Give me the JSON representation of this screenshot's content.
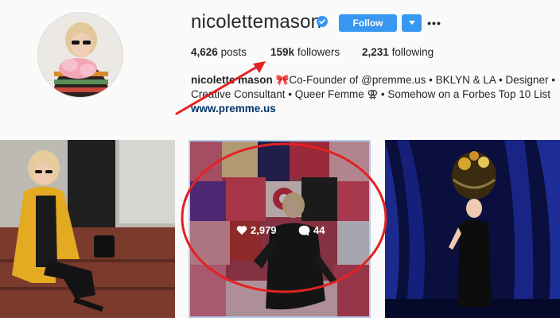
{
  "profile": {
    "username": "nicolettemason",
    "follow_label": "Follow",
    "stats": {
      "posts_count": "4,626",
      "posts_label": "posts",
      "followers_count": "159k",
      "followers_label": "followers",
      "following_count": "2,231",
      "following_label": "following"
    },
    "bio": {
      "name": "nicolette mason",
      "line1_rest": "🎀Co-Founder of",
      "mention": "@premme.us",
      "line1_tail": "• BKLYN & LA • Designer •",
      "line2": "Creative Consultant • Queer Femme ⚢ • Somehow on a Forbes Top 10 List",
      "link": "www.premme.us"
    }
  },
  "posts": [
    {
      "name": "post-yellow-cardigan"
    },
    {
      "name": "post-collage-wall",
      "likes": "2,979",
      "comments": "44"
    },
    {
      "name": "post-stage-headpiece"
    }
  ],
  "colors": {
    "accent": "#3897f0",
    "annotation": "#e32222",
    "link": "#003569"
  }
}
